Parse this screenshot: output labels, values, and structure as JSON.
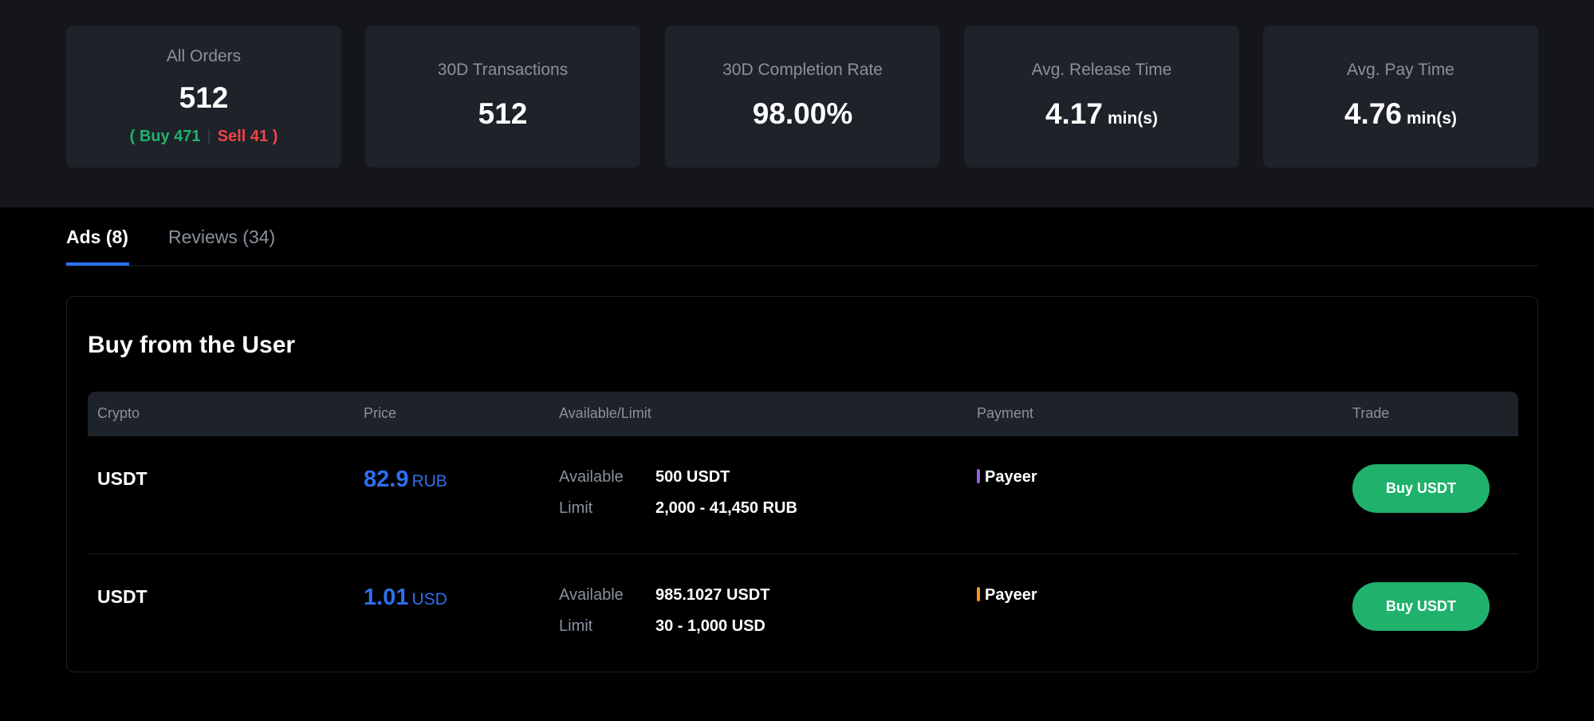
{
  "stats": [
    {
      "label": "All Orders",
      "value": "512"
    },
    {
      "label": "30D Transactions",
      "value": "512"
    },
    {
      "label": "30D Completion Rate",
      "value": "98.00%"
    },
    {
      "label": "Avg. Release Time",
      "value": "4.17",
      "unit": "min(s)"
    },
    {
      "label": "Avg. Pay Time",
      "value": "4.76",
      "unit": "min(s)"
    }
  ],
  "orders_breakdown": {
    "open": "(",
    "buy": "Buy 471",
    "sep": "|",
    "sell": "Sell 41",
    "close": ")"
  },
  "tabs": [
    {
      "label": "Ads (8)",
      "active": true
    },
    {
      "label": "Reviews (34)",
      "active": false
    }
  ],
  "panel": {
    "title": "Buy from the User",
    "columns": [
      "Crypto",
      "Price",
      "Available/Limit",
      "Payment",
      "Trade"
    ],
    "available_label": "Available",
    "limit_label": "Limit",
    "rows": [
      {
        "crypto": "USDT",
        "price": "82.9",
        "price_currency": "RUB",
        "available": "500 USDT",
        "limit": "2,000 - 41,450 RUB",
        "payment": "Payeer",
        "payment_color": "#9b5de5",
        "action": "Buy USDT"
      },
      {
        "crypto": "USDT",
        "price": "1.01",
        "price_currency": "USD",
        "available": "985.1027 USDT",
        "limit": "30 - 1,000 USD",
        "payment": "Payeer",
        "payment_color": "#f7931a",
        "action": "Buy USDT"
      }
    ]
  },
  "colors": {
    "accent": "#2d6ff0",
    "buy": "#20b26c",
    "sell": "#ef454a"
  }
}
